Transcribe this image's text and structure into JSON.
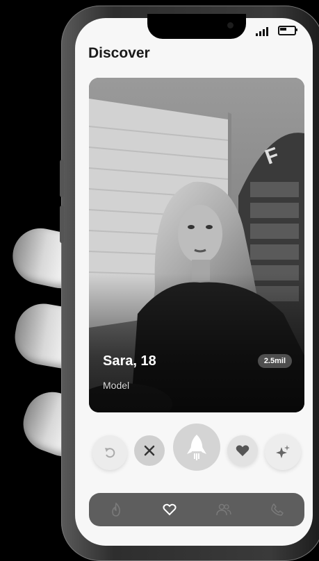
{
  "header": {
    "title": "Discover"
  },
  "profile": {
    "name": "Sara, 18",
    "occupation": "Model",
    "followers": "2.5mil"
  },
  "actions": [
    {
      "name": "rewind",
      "icon": "undo-icon"
    },
    {
      "name": "dislike",
      "icon": "close-icon"
    },
    {
      "name": "boost",
      "icon": "rocket-icon"
    },
    {
      "name": "like",
      "icon": "heart-icon"
    },
    {
      "name": "super-like",
      "icon": "sparkle-icon"
    }
  ],
  "nav": [
    {
      "name": "discover",
      "icon": "flame-icon",
      "active": false
    },
    {
      "name": "likes",
      "icon": "heart-outline-icon",
      "active": true
    },
    {
      "name": "matches",
      "icon": "users-icon",
      "active": false
    },
    {
      "name": "calls",
      "icon": "phone-icon",
      "active": false
    }
  ],
  "colors": {
    "background": "#000000",
    "screen": "#f7f7f7",
    "nav_bar": "#5e5e5e",
    "badge": "#5a5a5a"
  }
}
